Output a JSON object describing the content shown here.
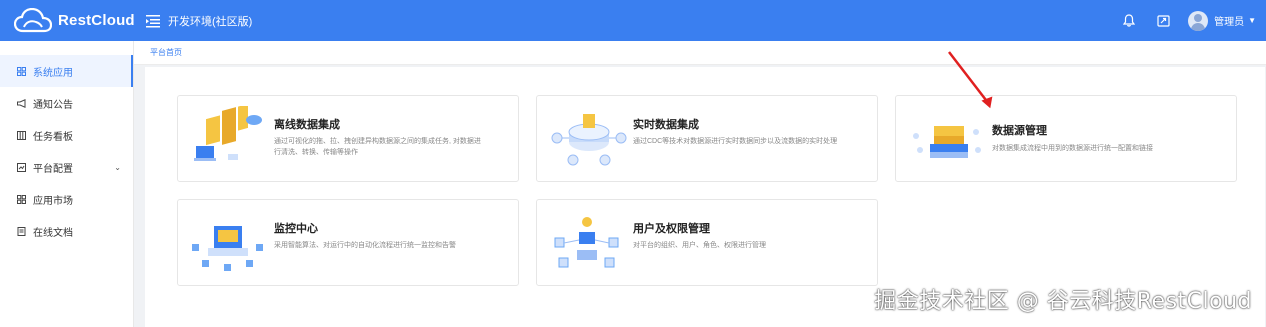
{
  "header": {
    "logo_text": "RestCloud",
    "env_title": "开发环境(社区版)",
    "user_name": "管理员",
    "brand_color": "#3a7ff0"
  },
  "sidebar": {
    "items": [
      {
        "label": "系统应用",
        "icon": "grid-icon",
        "active": true
      },
      {
        "label": "通知公告",
        "icon": "megaphone-icon"
      },
      {
        "label": "任务看板",
        "icon": "board-icon"
      },
      {
        "label": "平台配置",
        "icon": "window-icon",
        "has_chevron": true
      },
      {
        "label": "应用市场",
        "icon": "grid-icon"
      },
      {
        "label": "在线文档",
        "icon": "document-icon"
      }
    ]
  },
  "breadcrumb": {
    "home": "平台首页"
  },
  "cards": [
    {
      "title": "离线数据集成",
      "desc": "通过可视化的拖、拉、拽创建异构数据源之间的集成任务, 对数据进行清洗、转换、传输等操作"
    },
    {
      "title": "实时数据集成",
      "desc": "通过CDC等技术对数据源进行实时数据同步以及流数据的实时处理"
    },
    {
      "title": "数据源管理",
      "desc": "对数据集成流程中用到的数据源进行统一配置和链接"
    },
    {
      "title": "监控中心",
      "desc": "采用智能算法、对运行中的自动化流程进行统一监控和告警"
    },
    {
      "title": "用户及权限管理",
      "desc": "对平台的组织、用户、角色、权限进行管理"
    }
  ],
  "watermark": "掘金技术社区 @ 谷云科技RestCloud"
}
